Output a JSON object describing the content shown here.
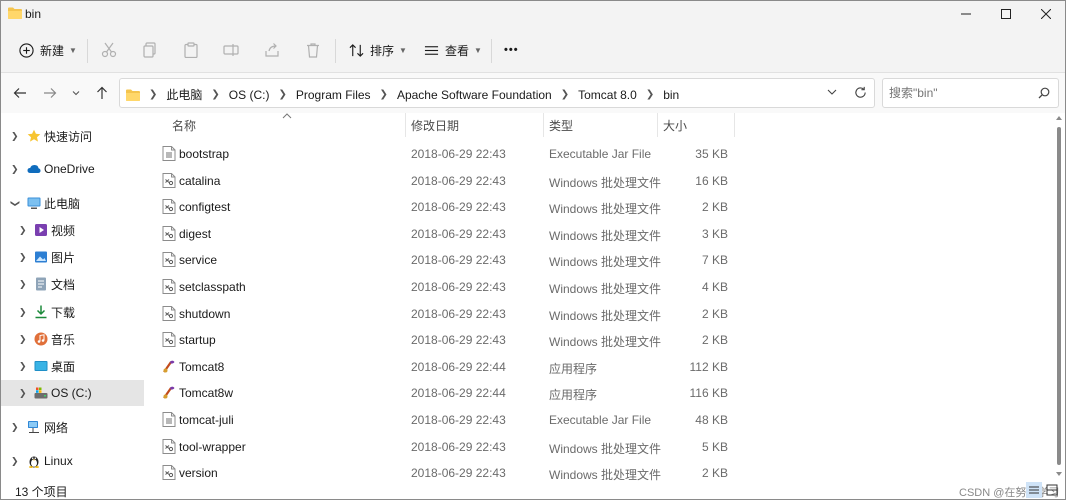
{
  "window": {
    "title": "bin"
  },
  "commandbar": {
    "new_label": "新建",
    "sort_label": "排序",
    "view_label": "查看",
    "more_label": "•••"
  },
  "address": {
    "crumbs": [
      "此电脑",
      "OS (C:)",
      "Program Files",
      "Apache Software Foundation",
      "Tomcat 8.0",
      "bin"
    ],
    "search_placeholder": "搜索\"bin\""
  },
  "navpane": {
    "items": [
      {
        "label": "快速访问",
        "icon": "star-icon"
      },
      {
        "label": "OneDrive",
        "icon": "cloud-icon"
      },
      {
        "label": "此电脑",
        "icon": "computer-icon"
      },
      {
        "label": "视频",
        "icon": "video-icon"
      },
      {
        "label": "图片",
        "icon": "picture-icon"
      },
      {
        "label": "文档",
        "icon": "document-icon"
      },
      {
        "label": "下载",
        "icon": "download-icon"
      },
      {
        "label": "音乐",
        "icon": "music-icon"
      },
      {
        "label": "桌面",
        "icon": "desktop-icon"
      },
      {
        "label": "OS (C:)",
        "icon": "drive-icon"
      },
      {
        "label": "网络",
        "icon": "network-icon"
      },
      {
        "label": "Linux",
        "icon": "linux-icon"
      }
    ]
  },
  "columns": {
    "name": "名称",
    "date": "修改日期",
    "type": "类型",
    "size": "大小"
  },
  "files": [
    {
      "name": "bootstrap",
      "date": "2018-06-29 22:43",
      "type": "Executable Jar File",
      "size": "35 KB",
      "icon": "jar"
    },
    {
      "name": "catalina",
      "date": "2018-06-29 22:43",
      "type": "Windows 批处理文件",
      "size": "16 KB",
      "icon": "bat"
    },
    {
      "name": "configtest",
      "date": "2018-06-29 22:43",
      "type": "Windows 批处理文件",
      "size": "2 KB",
      "icon": "bat"
    },
    {
      "name": "digest",
      "date": "2018-06-29 22:43",
      "type": "Windows 批处理文件",
      "size": "3 KB",
      "icon": "bat"
    },
    {
      "name": "service",
      "date": "2018-06-29 22:43",
      "type": "Windows 批处理文件",
      "size": "7 KB",
      "icon": "bat"
    },
    {
      "name": "setclasspath",
      "date": "2018-06-29 22:43",
      "type": "Windows 批处理文件",
      "size": "4 KB",
      "icon": "bat"
    },
    {
      "name": "shutdown",
      "date": "2018-06-29 22:43",
      "type": "Windows 批处理文件",
      "size": "2 KB",
      "icon": "bat"
    },
    {
      "name": "startup",
      "date": "2018-06-29 22:43",
      "type": "Windows 批处理文件",
      "size": "2 KB",
      "icon": "bat"
    },
    {
      "name": "Tomcat8",
      "date": "2018-06-29 22:44",
      "type": "应用程序",
      "size": "112 KB",
      "icon": "exe"
    },
    {
      "name": "Tomcat8w",
      "date": "2018-06-29 22:44",
      "type": "应用程序",
      "size": "116 KB",
      "icon": "exe"
    },
    {
      "name": "tomcat-juli",
      "date": "2018-06-29 22:43",
      "type": "Executable Jar File",
      "size": "48 KB",
      "icon": "jar"
    },
    {
      "name": "tool-wrapper",
      "date": "2018-06-29 22:43",
      "type": "Windows 批处理文件",
      "size": "5 KB",
      "icon": "bat"
    },
    {
      "name": "version",
      "date": "2018-06-29 22:43",
      "type": "Windows 批处理文件",
      "size": "2 KB",
      "icon": "bat"
    }
  ],
  "status": {
    "item_count": "13 个项目",
    "watermark": "CSDN @在努力学习"
  },
  "colors": {
    "accent": "#0067c0",
    "folder": "#f4c44e",
    "selected_nav": "#e5e5e5"
  }
}
